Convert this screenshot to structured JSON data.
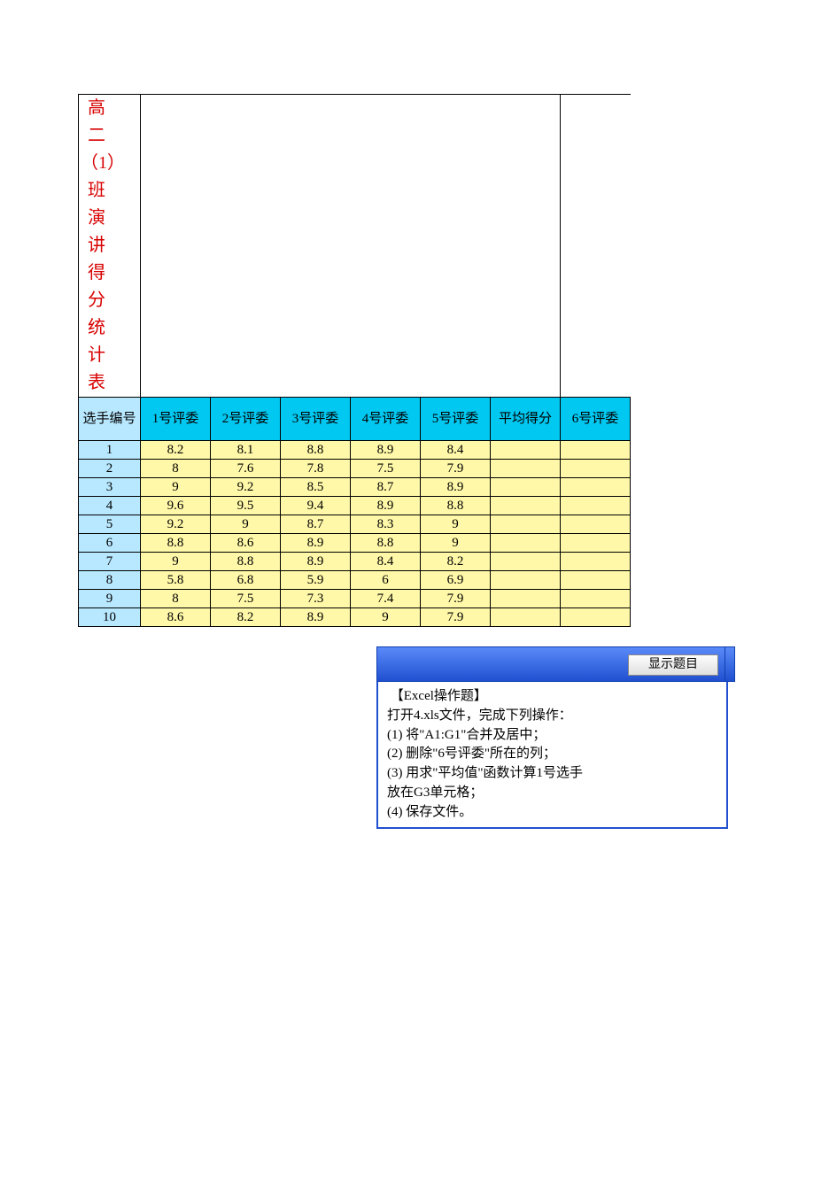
{
  "title": "高二（1）班演讲得分统计表",
  "headers": {
    "rowhead": "选手编号",
    "cols": [
      "1号评委",
      "2号评委",
      "3号评委",
      "4号评委",
      "5号评委",
      "平均得分",
      "6号评委"
    ]
  },
  "rows": [
    {
      "id": "1",
      "v": [
        "8.2",
        "8.1",
        "8.8",
        "8.9",
        "8.4",
        "",
        ""
      ]
    },
    {
      "id": "2",
      "v": [
        "8",
        "7.6",
        "7.8",
        "7.5",
        "7.9",
        "",
        ""
      ]
    },
    {
      "id": "3",
      "v": [
        "9",
        "9.2",
        "8.5",
        "8.7",
        "8.9",
        "",
        ""
      ]
    },
    {
      "id": "4",
      "v": [
        "9.6",
        "9.5",
        "9.4",
        "8.9",
        "8.8",
        "",
        ""
      ]
    },
    {
      "id": "5",
      "v": [
        "9.2",
        "9",
        "8.7",
        "8.3",
        "9",
        "",
        ""
      ]
    },
    {
      "id": "6",
      "v": [
        "8.8",
        "8.6",
        "8.9",
        "8.8",
        "9",
        "",
        ""
      ]
    },
    {
      "id": "7",
      "v": [
        "9",
        "8.8",
        "8.9",
        "8.4",
        "8.2",
        "",
        ""
      ]
    },
    {
      "id": "8",
      "v": [
        "5.8",
        "6.8",
        "5.9",
        "6",
        "6.9",
        "",
        ""
      ]
    },
    {
      "id": "9",
      "v": [
        "8",
        "7.5",
        "7.3",
        "7.4",
        "7.9",
        "",
        ""
      ]
    },
    {
      "id": "10",
      "v": [
        "8.6",
        "8.2",
        "8.9",
        "9",
        "7.9",
        "",
        ""
      ]
    }
  ],
  "chart_data": {
    "type": "table",
    "title": "高二（1）班演讲得分统计表",
    "columns": [
      "选手编号",
      "1号评委",
      "2号评委",
      "3号评委",
      "4号评委",
      "5号评委",
      "平均得分",
      "6号评委"
    ],
    "rows": [
      [
        1,
        8.2,
        8.1,
        8.8,
        8.9,
        8.4,
        null,
        null
      ],
      [
        2,
        8,
        7.6,
        7.8,
        7.5,
        7.9,
        null,
        null
      ],
      [
        3,
        9,
        9.2,
        8.5,
        8.7,
        8.9,
        null,
        null
      ],
      [
        4,
        9.6,
        9.5,
        9.4,
        8.9,
        8.8,
        null,
        null
      ],
      [
        5,
        9.2,
        9,
        8.7,
        8.3,
        9,
        null,
        null
      ],
      [
        6,
        8.8,
        8.6,
        8.9,
        8.8,
        9,
        null,
        null
      ],
      [
        7,
        9,
        8.8,
        8.9,
        8.4,
        8.2,
        null,
        null
      ],
      [
        8,
        5.8,
        6.8,
        5.9,
        6,
        6.9,
        null,
        null
      ],
      [
        9,
        8,
        7.5,
        7.3,
        7.4,
        7.9,
        null,
        null
      ],
      [
        10,
        8.6,
        8.2,
        8.9,
        9,
        7.9,
        null,
        null
      ]
    ]
  },
  "instructions": {
    "button": "显示题目",
    "lines": [
      " 【Excel操作题】",
      "打开4.xls文件，完成下列操作：",
      "(1) 将\"A1:G1\"合并及居中；",
      "(2) 删除\"6号评委\"所在的列；",
      "(3) 用求\"平均值\"函数计算1号选手",
      "放在G3单元格；",
      "(4) 保存文件。"
    ]
  }
}
